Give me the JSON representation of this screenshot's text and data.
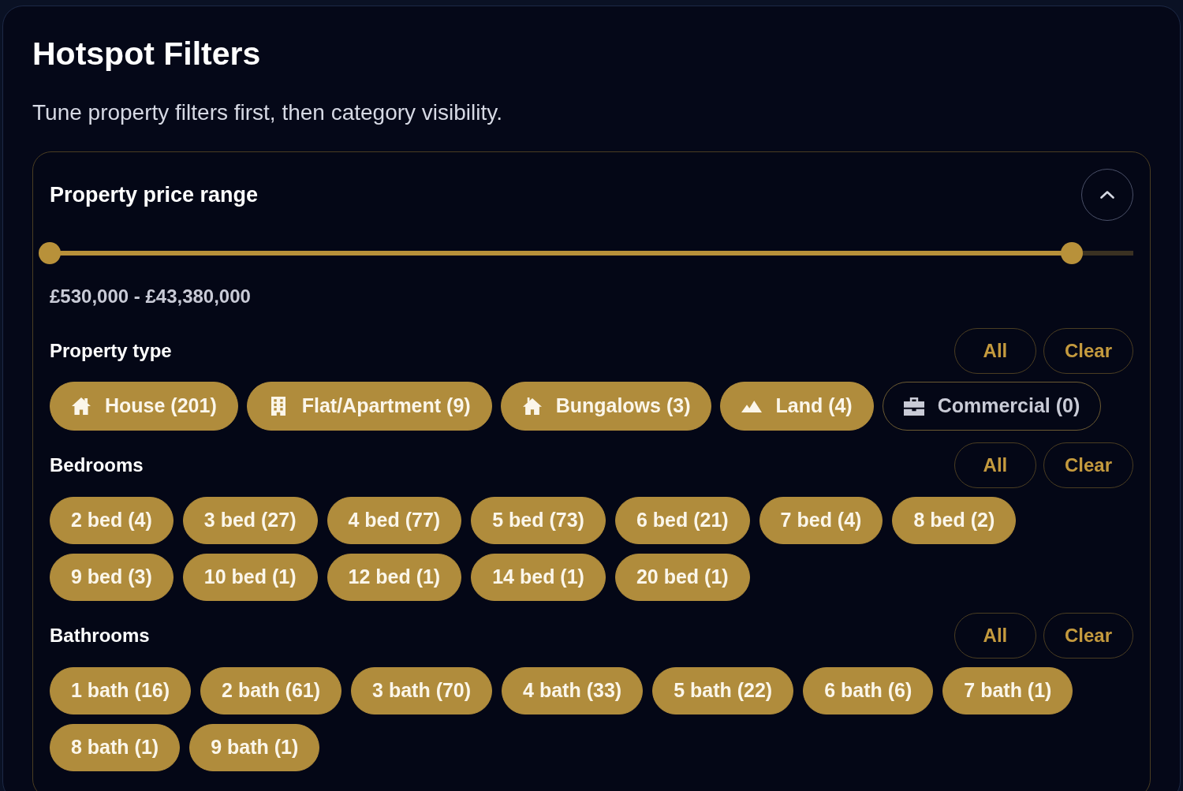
{
  "panel": {
    "title": "Hotspot Filters",
    "subtitle": "Tune property filters first, then category visibility."
  },
  "price_range": {
    "title": "Property price range",
    "expanded": true,
    "low": {
      "level": 0
    },
    "high": {
      "level": 0.943
    },
    "reading": "£530,000 - £43,380,000"
  },
  "groups": [
    {
      "title": "Property type",
      "actions": [
        "All",
        "Clear"
      ],
      "options": [
        {
          "label": "House (201)",
          "kind": "house",
          "selected": true
        },
        {
          "label": "Flat/Apartment (9)",
          "kind": "flat",
          "selected": true
        },
        {
          "label": "Bungalows (3)",
          "kind": "bungalow",
          "selected": true
        },
        {
          "label": "Land (4)",
          "kind": "land",
          "selected": true
        },
        {
          "label": "Commercial (0)",
          "kind": "commercial",
          "selected": false
        }
      ]
    },
    {
      "title": "Bedrooms",
      "actions": [
        "All",
        "Clear"
      ],
      "options": [
        {
          "label": "2 bed (4)",
          "selected": true
        },
        {
          "label": "3 bed (27)",
          "selected": true
        },
        {
          "label": "4 bed (77)",
          "selected": true
        },
        {
          "label": "5 bed (73)",
          "selected": true
        },
        {
          "label": "6 bed (21)",
          "selected": true
        },
        {
          "label": "7 bed (4)",
          "selected": true
        },
        {
          "label": "8 bed (2)",
          "selected": true
        },
        {
          "label": "9 bed (3)",
          "selected": true
        },
        {
          "label": "10 bed (1)",
          "selected": true
        },
        {
          "label": "12 bed (1)",
          "selected": true
        },
        {
          "label": "14 bed (1)",
          "selected": true
        },
        {
          "label": "20 bed (1)",
          "selected": true
        }
      ]
    },
    {
      "title": "Bathrooms",
      "actions": [
        "All",
        "Clear"
      ],
      "options": [
        {
          "label": "1 bath (16)",
          "selected": true
        },
        {
          "label": "2 bath (61)",
          "selected": true
        },
        {
          "label": "3 bath (70)",
          "selected": true
        },
        {
          "label": "4 bath (33)",
          "selected": true
        },
        {
          "label": "5 bath (22)",
          "selected": true
        },
        {
          "label": "6 bath (6)",
          "selected": true
        },
        {
          "label": "7 bath (1)",
          "selected": true
        },
        {
          "label": "8 bath (1)",
          "selected": true
        },
        {
          "label": "9 bath (1)",
          "selected": true
        }
      ]
    }
  ]
}
